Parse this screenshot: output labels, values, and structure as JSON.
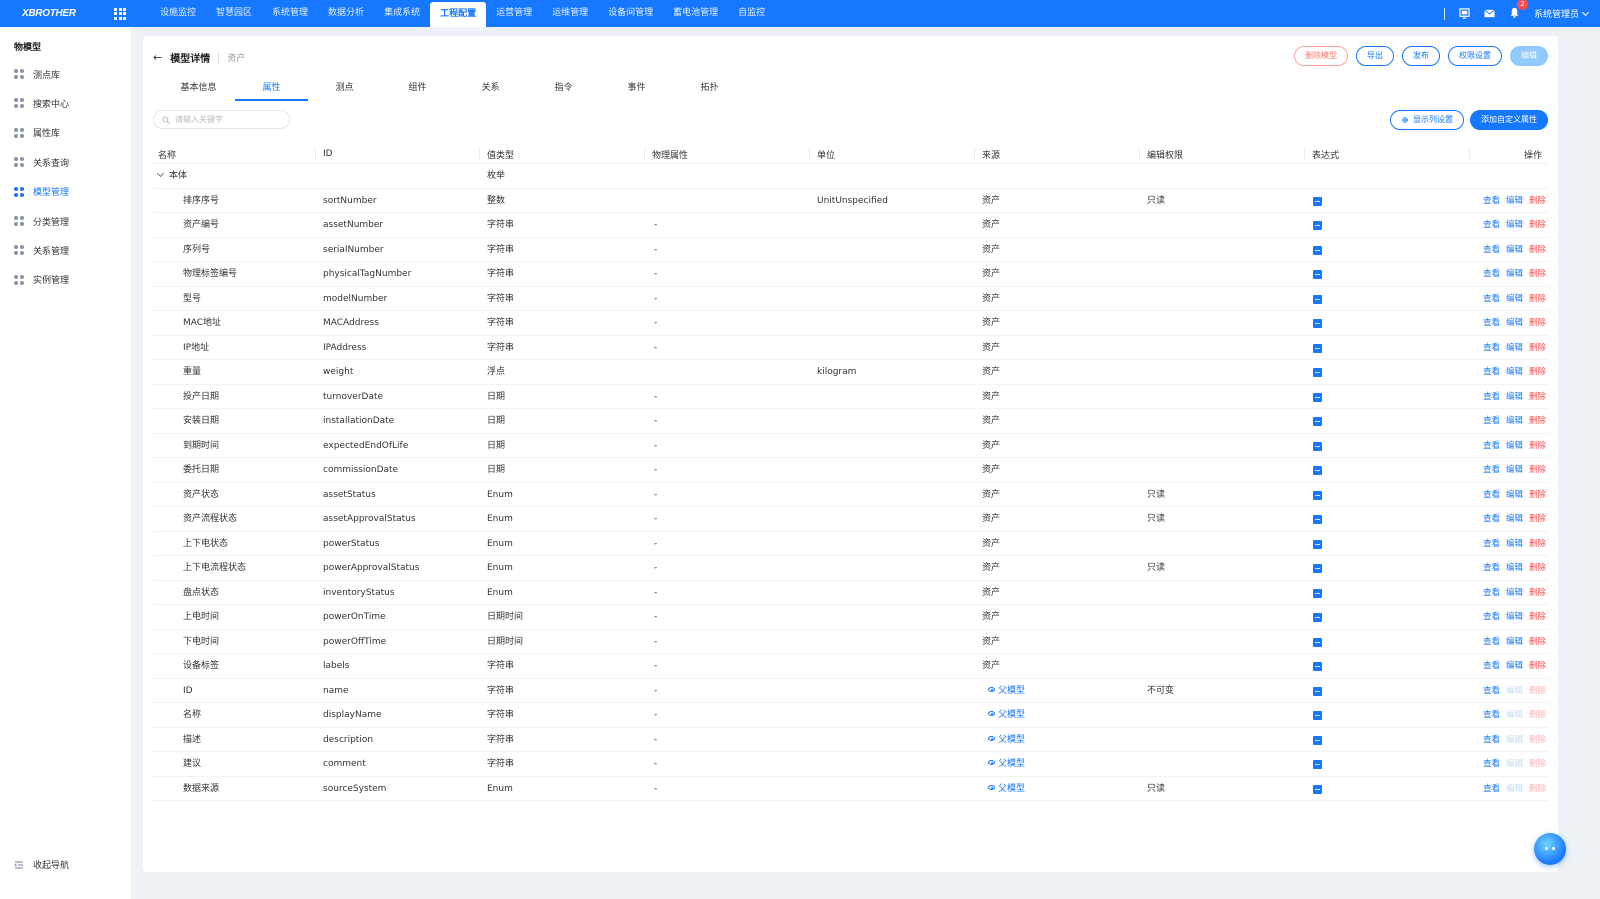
{
  "app": {
    "logo": "XBROTHER"
  },
  "topnav": {
    "items": [
      "设施监控",
      "智慧园区",
      "系统管理",
      "数据分析",
      "集成系统",
      "工程配置",
      "运营管理",
      "运维管理",
      "设备间管理",
      "蓄电池管理",
      "自监控"
    ],
    "active_index": 5,
    "notification_count": "2",
    "user": "系统管理员"
  },
  "sidebar": {
    "title": "物模型",
    "items": [
      "测点库",
      "搜索中心",
      "属性库",
      "关系查询",
      "模型管理",
      "分类管理",
      "关系管理",
      "实例管理"
    ],
    "active_index": 4,
    "collapse_label": "收起导航"
  },
  "page": {
    "title": "模型详情",
    "subtitle": "资产",
    "buttons": {
      "delete_model": "删除模型",
      "export": "导出",
      "publish": "发布",
      "permission": "权限设置",
      "edit": "编辑"
    },
    "tabs": [
      "基本信息",
      "属性",
      "测点",
      "组件",
      "关系",
      "指令",
      "事件",
      "拓扑"
    ],
    "active_tab": 1,
    "search_placeholder": "请输入关键字",
    "column_settings": "显示列设置",
    "add_custom": "添加自定义属性"
  },
  "table": {
    "columns": [
      "名称",
      "ID",
      "值类型",
      "物理属性",
      "单位",
      "来源",
      "编辑权限",
      "表达式",
      "操作"
    ],
    "group": {
      "name": "本体",
      "type": "枚举"
    },
    "op_labels": {
      "view": "查看",
      "edit": "编辑",
      "delete": "删除"
    },
    "rows": [
      {
        "name": "排序序号",
        "id": "sortNumber",
        "type": "整数",
        "phys": "",
        "unit": "UnitUnspecified",
        "source": "资产",
        "perm": "只读",
        "inherited": false
      },
      {
        "name": "资产编号",
        "id": "assetNumber",
        "type": "字符串",
        "phys": "-",
        "unit": "",
        "source": "资产",
        "perm": "",
        "inherited": false
      },
      {
        "name": "序列号",
        "id": "serialNumber",
        "type": "字符串",
        "phys": "-",
        "unit": "",
        "source": "资产",
        "perm": "",
        "inherited": false
      },
      {
        "name": "物理标签编号",
        "id": "physicalTagNumber",
        "type": "字符串",
        "phys": "-",
        "unit": "",
        "source": "资产",
        "perm": "",
        "inherited": false
      },
      {
        "name": "型号",
        "id": "modelNumber",
        "type": "字符串",
        "phys": "-",
        "unit": "",
        "source": "资产",
        "perm": "",
        "inherited": false
      },
      {
        "name": "MAC地址",
        "id": "MACAddress",
        "type": "字符串",
        "phys": "-",
        "unit": "",
        "source": "资产",
        "perm": "",
        "inherited": false
      },
      {
        "name": "IP地址",
        "id": "IPAddress",
        "type": "字符串",
        "phys": "-",
        "unit": "",
        "source": "资产",
        "perm": "",
        "inherited": false
      },
      {
        "name": "重量",
        "id": "weight",
        "type": "浮点",
        "phys": "",
        "unit": "kilogram",
        "source": "资产",
        "perm": "",
        "inherited": false
      },
      {
        "name": "投产日期",
        "id": "turnoverDate",
        "type": "日期",
        "phys": "-",
        "unit": "",
        "source": "资产",
        "perm": "",
        "inherited": false
      },
      {
        "name": "安装日期",
        "id": "installationDate",
        "type": "日期",
        "phys": "-",
        "unit": "",
        "source": "资产",
        "perm": "",
        "inherited": false
      },
      {
        "name": "到期时间",
        "id": "expectedEndOfLife",
        "type": "日期",
        "phys": "-",
        "unit": "",
        "source": "资产",
        "perm": "",
        "inherited": false
      },
      {
        "name": "委托日期",
        "id": "commissionDate",
        "type": "日期",
        "phys": "-",
        "unit": "",
        "source": "资产",
        "perm": "",
        "inherited": false
      },
      {
        "name": "资产状态",
        "id": "assetStatus",
        "type": "Enum",
        "phys": "-",
        "unit": "",
        "source": "资产",
        "perm": "只读",
        "inherited": false
      },
      {
        "name": "资产流程状态",
        "id": "assetApprovalStatus",
        "type": "Enum",
        "phys": "-",
        "unit": "",
        "source": "资产",
        "perm": "只读",
        "inherited": false
      },
      {
        "name": "上下电状态",
        "id": "powerStatus",
        "type": "Enum",
        "phys": "-",
        "unit": "",
        "source": "资产",
        "perm": "",
        "inherited": false
      },
      {
        "name": "上下电流程状态",
        "id": "powerApprovalStatus",
        "type": "Enum",
        "phys": "-",
        "unit": "",
        "source": "资产",
        "perm": "只读",
        "inherited": false
      },
      {
        "name": "盘点状态",
        "id": "inventoryStatus",
        "type": "Enum",
        "phys": "-",
        "unit": "",
        "source": "资产",
        "perm": "",
        "inherited": false
      },
      {
        "name": "上电时间",
        "id": "powerOnTime",
        "type": "日期时间",
        "phys": "-",
        "unit": "",
        "source": "资产",
        "perm": "",
        "inherited": false
      },
      {
        "name": "下电时间",
        "id": "powerOffTime",
        "type": "日期时间",
        "phys": "-",
        "unit": "",
        "source": "资产",
        "perm": "",
        "inherited": false
      },
      {
        "name": "设备标签",
        "id": "labels",
        "type": "字符串",
        "phys": "-",
        "unit": "",
        "source": "资产",
        "perm": "",
        "inherited": false
      },
      {
        "name": "ID",
        "id": "name",
        "type": "字符串",
        "phys": "-",
        "unit": "",
        "source": "父模型",
        "perm": "不可变",
        "inherited": true
      },
      {
        "name": "名称",
        "id": "displayName",
        "type": "字符串",
        "phys": "-",
        "unit": "",
        "source": "父模型",
        "perm": "",
        "inherited": true
      },
      {
        "name": "描述",
        "id": "description",
        "type": "字符串",
        "phys": "-",
        "unit": "",
        "source": "父模型",
        "perm": "",
        "inherited": true
      },
      {
        "name": "建议",
        "id": "comment",
        "type": "字符串",
        "phys": "-",
        "unit": "",
        "source": "父模型",
        "perm": "",
        "inherited": true
      },
      {
        "name": "数据来源",
        "id": "sourceSystem",
        "type": "Enum",
        "phys": "-",
        "unit": "",
        "source": "父模型",
        "perm": "只读",
        "inherited": true
      }
    ]
  },
  "colors": {
    "primary": "#1677ff",
    "danger": "#ff4d4f",
    "bg": "#eef1f5"
  }
}
